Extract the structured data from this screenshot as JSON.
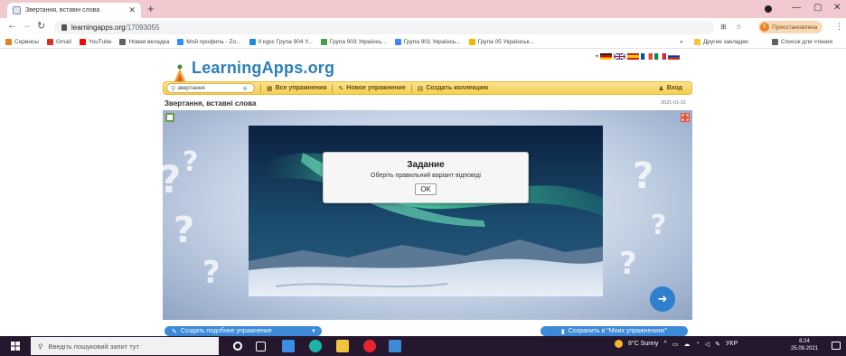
{
  "browser": {
    "tab_title": "Звертання, вставні слова",
    "tab_close": "✕",
    "new_tab": "+",
    "url_host": "learningapps.org",
    "url_path": "/17093055",
    "profile_initial": "K",
    "profile_label": "Приостановлена",
    "win_minimize": "—",
    "win_maximize": "▢",
    "win_close": "✕"
  },
  "bookmarks": [
    {
      "label": "Сервисы",
      "color": "#e8821e"
    },
    {
      "label": "Gmail",
      "color": "#d93025"
    },
    {
      "label": "YouTube",
      "color": "#ff0000"
    },
    {
      "label": "Новая вкладка",
      "color": "#5f6368"
    },
    {
      "label": "Мой профиль - Zo...",
      "color": "#2d8cff"
    },
    {
      "label": "ІІ курс Група 904 У...",
      "color": "#1e88e5"
    },
    {
      "label": "Група 903 Українсь...",
      "color": "#43a047"
    },
    {
      "label": "Група 901 Українсь...",
      "color": "#4285f4"
    },
    {
      "label": "Група 05 Українськ...",
      "color": "#f4b400"
    }
  ],
  "bookmarks_more": "»",
  "bookmarks_other": "Другие закладки",
  "bookmarks_reading": "Список для чтения",
  "site": {
    "logo_text": "LearningApps.org",
    "search_value": "звертання",
    "search_clear": "⊗",
    "nav_all": "Все упражнения",
    "nav_new": "Новое упражнение",
    "nav_collection": "Создать коллекцию",
    "nav_login": "Вход",
    "exercise_title": "Звертання, вставні слова",
    "exercise_date": "2021-01-31",
    "btn_create_similar": "Создать подобное упражнение",
    "btn_save": "Сохранить в \"Моих упражнениях\""
  },
  "dialog": {
    "title": "Задание",
    "message": "Оберіть правильний варіант відповіді",
    "ok": "OK"
  },
  "taskbar": {
    "search_placeholder": "Введіть пошуковий запит тут",
    "weather": "8°C Sunny",
    "lang": "УКР",
    "time": "8:24",
    "date": "25.09.2021"
  },
  "colors": {
    "tabstrip": "#f2c9cf",
    "navbar": "#f4cf55",
    "accent_blue": "#3c8ad8",
    "taskbar": "#25172e"
  }
}
